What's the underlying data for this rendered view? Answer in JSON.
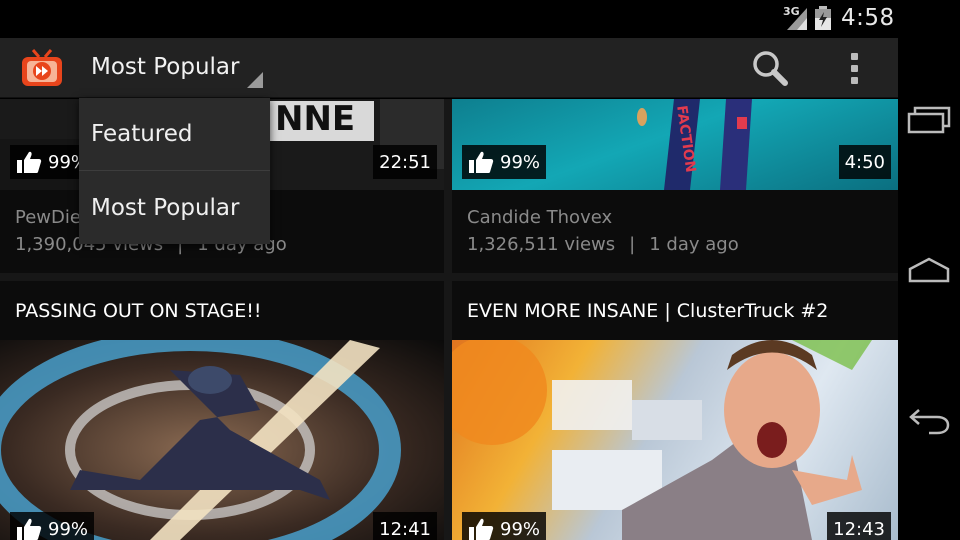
{
  "status_bar": {
    "network": "3G",
    "time": "4:58"
  },
  "action_bar": {
    "view_selector": "Most Popular",
    "icons": {
      "logo": "tube-app-logo-icon",
      "search": "search-icon",
      "overflow": "overflow-menu-icon"
    }
  },
  "dropdown": {
    "items": [
      {
        "label": "Featured"
      },
      {
        "label": "Most Popular"
      }
    ]
  },
  "videos": [
    {
      "likes": "99%",
      "duration": "22:51",
      "channel": "PewDiePie",
      "views": "1,390,045 views",
      "age": "1 day ago",
      "thumb_text": "NNE"
    },
    {
      "likes": "99%",
      "duration": "4:50",
      "channel": "Candide Thovex",
      "views": "1,326,511 views",
      "age": "1 day ago",
      "ski_text": "FACTION"
    },
    {
      "title": "PASSING OUT ON STAGE!!",
      "likes": "99%",
      "duration": "12:41"
    },
    {
      "title": "EVEN MORE INSANE | ClusterTruck #2",
      "likes": "99%",
      "duration": "12:43"
    }
  ],
  "meta_separator": "|",
  "colors": {
    "accent": "#e8451c",
    "background": "#171717",
    "card": "#0c0c0c",
    "action_bar": "#222222"
  },
  "nav_icons": [
    "recent-apps-icon",
    "home-icon",
    "back-icon"
  ]
}
